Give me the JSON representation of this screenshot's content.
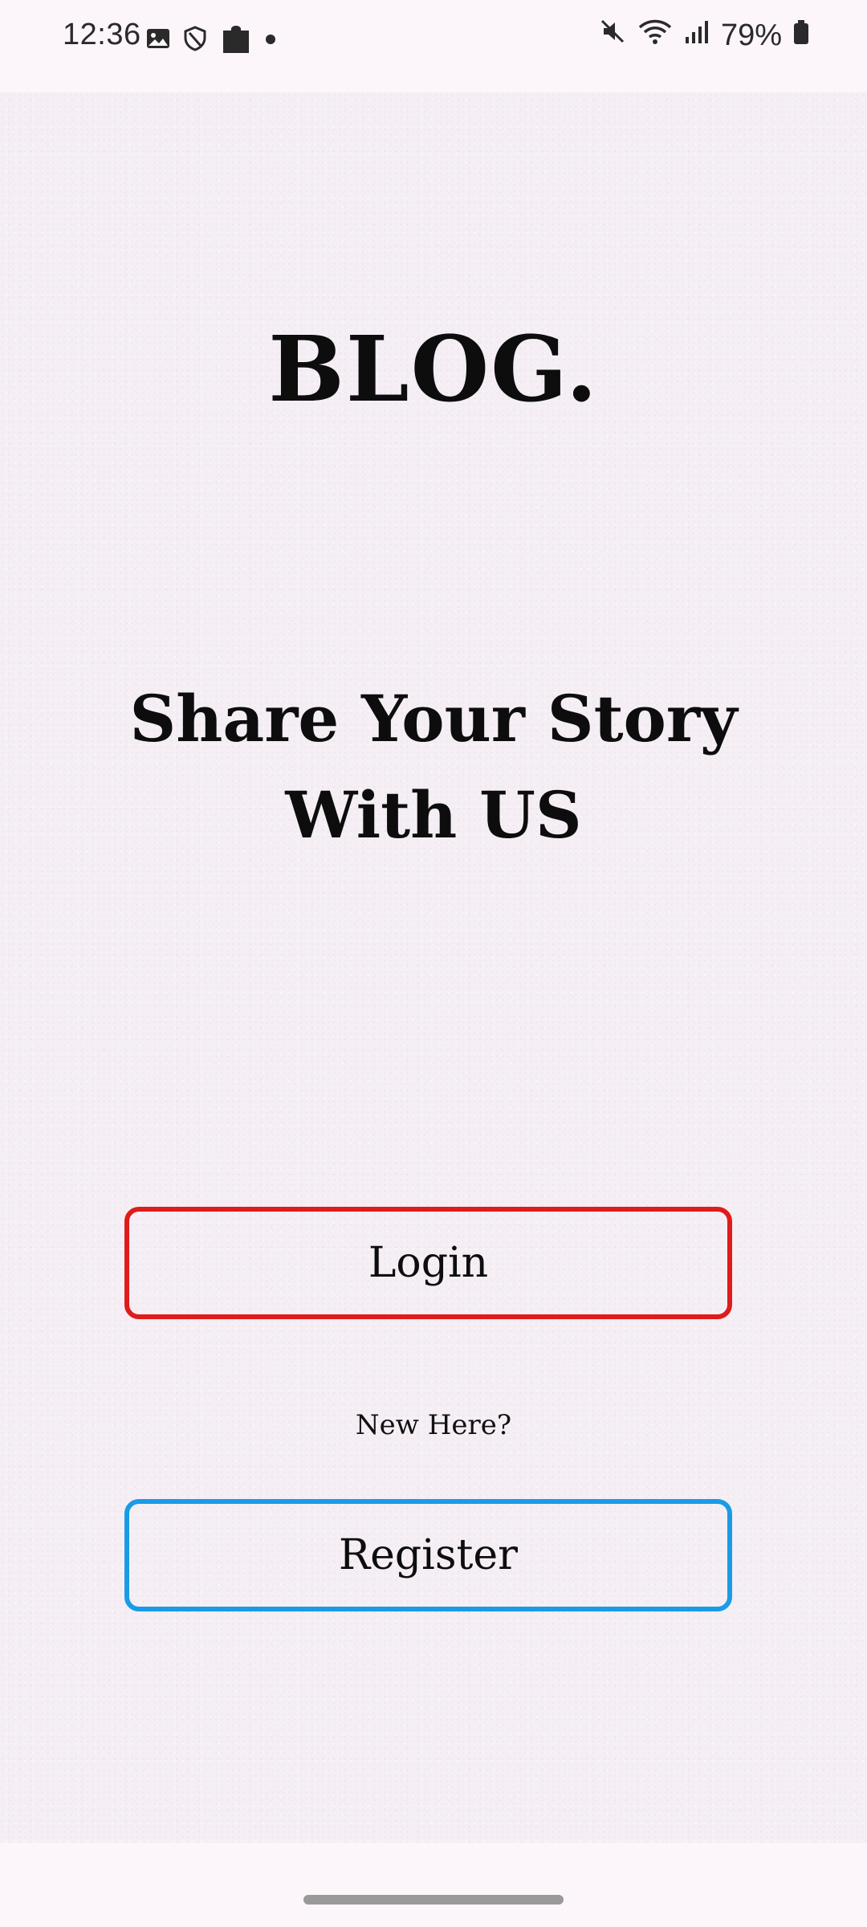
{
  "status_bar": {
    "time": "12:36",
    "left_icons": [
      "image-icon",
      "shield-icon",
      "puzzle-icon",
      "dot-icon"
    ],
    "right_icons": [
      "mute-icon",
      "wifi-icon",
      "signal-icon"
    ],
    "battery": "79%"
  },
  "brand": {
    "title": "BLOG."
  },
  "tagline": {
    "line1": "Share Your Story",
    "line2": "With US"
  },
  "actions": {
    "login_label": "Login",
    "new_here_text": "New Here?",
    "register_label": "Register"
  },
  "colors": {
    "login_border": "#e01b1b",
    "register_border": "#1a9be6",
    "background": "#f5eff5"
  }
}
